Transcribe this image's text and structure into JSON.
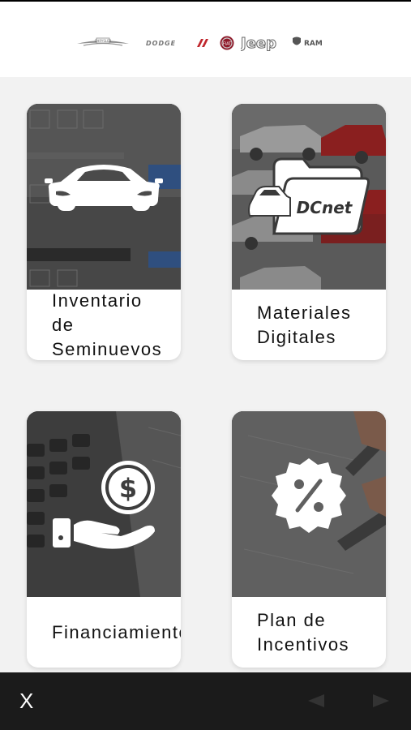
{
  "brands": [
    {
      "name": "CHRYSLER",
      "icon": "chrysler-logo"
    },
    {
      "name": "DODGE",
      "icon": "dodge-logo"
    },
    {
      "name": "FIAT",
      "icon": "fiat-logo"
    },
    {
      "name": "Jeep",
      "icon": "jeep-logo"
    },
    {
      "name": "RAM",
      "icon": "ram-logo"
    }
  ],
  "cards": [
    {
      "label": "Inventario\nde\nSeminuevos",
      "icon": "car-icon"
    },
    {
      "label": "Materiales\nDigitales",
      "icon": "dcnet-folder-icon",
      "icon_text": "DCnet"
    },
    {
      "label": "Financiamiento",
      "icon": "hand-dollar-icon",
      "icon_text": "$"
    },
    {
      "label": "Plan de\nIncentivos",
      "icon": "percent-badge-icon",
      "icon_text": "%"
    }
  ],
  "footer": {
    "close_label": "X",
    "prev_icon": "prev-arrow-icon",
    "next_icon": "next-arrow-icon"
  },
  "colors": {
    "background": "#f2f2f2",
    "footer": "#1b1b1b",
    "card": "#ffffff",
    "text": "#111111"
  }
}
